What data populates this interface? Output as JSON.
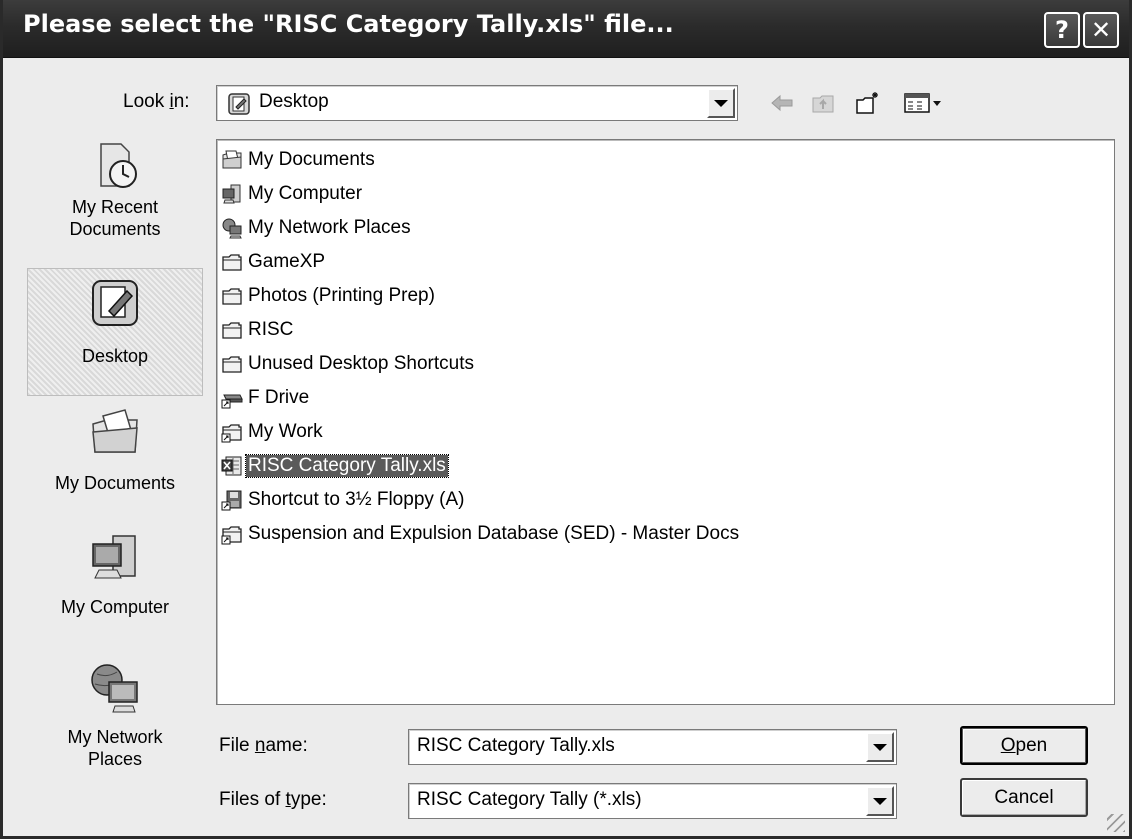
{
  "window": {
    "title": "Please select the \"RISC Category Tally.xls\" file...",
    "help_glyph": "?",
    "close_glyph": "✕"
  },
  "lookin": {
    "label_pre": "Look ",
    "label_u": "i",
    "label_post": "n:",
    "value": "Desktop",
    "icon": "desktop-icon"
  },
  "toolbar": {
    "icons": [
      "back-arrow-icon",
      "up-folder-icon",
      "new-folder-icon",
      "views-menu-icon"
    ]
  },
  "places": [
    {
      "label": "My Recent\nDocuments",
      "icon": "recent-documents-icon",
      "selected": false
    },
    {
      "label": "Desktop",
      "icon": "desktop-icon",
      "selected": true
    },
    {
      "label": "My Documents",
      "icon": "my-documents-icon",
      "selected": false
    },
    {
      "label": "My Computer",
      "icon": "my-computer-icon",
      "selected": false
    },
    {
      "label": "My Network\nPlaces",
      "icon": "network-places-icon",
      "selected": false
    }
  ],
  "files": [
    {
      "name": "My Documents",
      "icon": "my-documents-icon",
      "selected": false
    },
    {
      "name": "My Computer",
      "icon": "my-computer-icon",
      "selected": false
    },
    {
      "name": "My Network Places",
      "icon": "network-places-icon",
      "selected": false
    },
    {
      "name": "GameXP",
      "icon": "folder-icon",
      "selected": false
    },
    {
      "name": "Photos (Printing Prep)",
      "icon": "folder-icon",
      "selected": false
    },
    {
      "name": "RISC",
      "icon": "folder-icon",
      "selected": false
    },
    {
      "name": "Unused Desktop Shortcuts",
      "icon": "folder-icon",
      "selected": false
    },
    {
      "name": "F Drive",
      "icon": "network-drive-shortcut-icon",
      "selected": false
    },
    {
      "name": "My Work",
      "icon": "folder-shortcut-icon",
      "selected": false
    },
    {
      "name": "RISC Category Tally.xls",
      "icon": "excel-file-icon",
      "selected": true
    },
    {
      "name": "Shortcut to 3½ Floppy (A)",
      "icon": "floppy-shortcut-icon",
      "selected": false
    },
    {
      "name": "Suspension and Expulsion Database (SED) - Master Docs",
      "icon": "folder-shortcut-icon",
      "selected": false
    }
  ],
  "filename": {
    "label_pre": "File ",
    "label_u": "n",
    "label_post": "ame:",
    "value": "RISC Category Tally.xls"
  },
  "filetype": {
    "label_pre": "Files of ",
    "label_u": "t",
    "label_post": "ype:",
    "value": "RISC Category Tally (*.xls)"
  },
  "buttons": {
    "open_u": "O",
    "open_rest": "pen",
    "cancel": "Cancel"
  }
}
